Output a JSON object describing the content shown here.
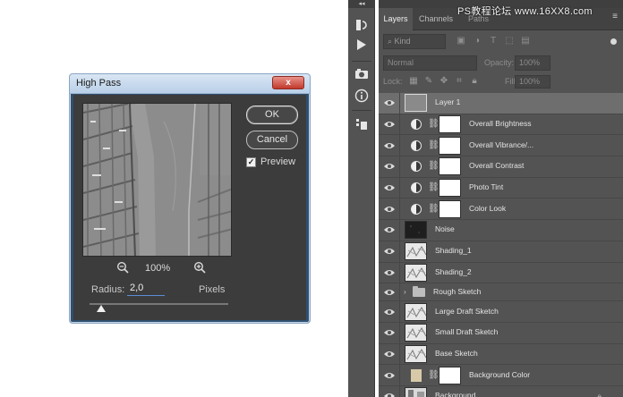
{
  "watermark": "PS教程论坛 www.16XX8.com",
  "high_pass": {
    "title": "High Pass",
    "close_label": "x",
    "ok_label": "OK",
    "cancel_label": "Cancel",
    "preview_label": "Preview",
    "preview_checked": true,
    "zoom_value": "100%",
    "radius_label": "Radius:",
    "radius_value": "2,0",
    "radius_unit": "Pixels"
  },
  "toolstrip": {
    "collapse_glyph": "◂◂",
    "tools": [
      "history-icon",
      "play-icon",
      "color-icon",
      "info-icon",
      "layer-comps-icon"
    ]
  },
  "panel": {
    "tabs": [
      "Layers",
      "Channels",
      "Paths"
    ],
    "filter_kind": "Kind",
    "blend_mode": "Normal",
    "opacity_label": "Opacity:",
    "opacity_value": "100%",
    "lock_label": "Lock:",
    "fill_label": "Fill:",
    "fill_value": "100%",
    "layers": [
      {
        "name": "Layer 1",
        "type": "pixel",
        "selected": true
      },
      {
        "name": "Overall Brightness",
        "type": "adjustment"
      },
      {
        "name": "Overall Vibrance/...",
        "type": "adjustment"
      },
      {
        "name": "Overall Contrast",
        "type": "adjustment"
      },
      {
        "name": "Photo Tint",
        "type": "adjustment"
      },
      {
        "name": "Color Look",
        "type": "adjustment"
      },
      {
        "name": "Noise",
        "type": "pixel"
      },
      {
        "name": "Shading_1",
        "type": "pixel"
      },
      {
        "name": "Shading_2",
        "type": "pixel"
      },
      {
        "name": "Rough Sketch",
        "type": "group"
      },
      {
        "name": "Large Draft Sketch",
        "type": "pixel"
      },
      {
        "name": "Small Draft Sketch",
        "type": "pixel"
      },
      {
        "name": "Base Sketch",
        "type": "pixel"
      },
      {
        "name": "Background Color",
        "type": "fill"
      },
      {
        "name": "Background",
        "type": "pixel",
        "locked": true
      }
    ]
  },
  "colors": {
    "panel_bg": "#535353",
    "selected_row": "#6e6e6e",
    "dialog_bg": "#3c3c3c",
    "background_color_swatch": "#d8c9a8"
  }
}
